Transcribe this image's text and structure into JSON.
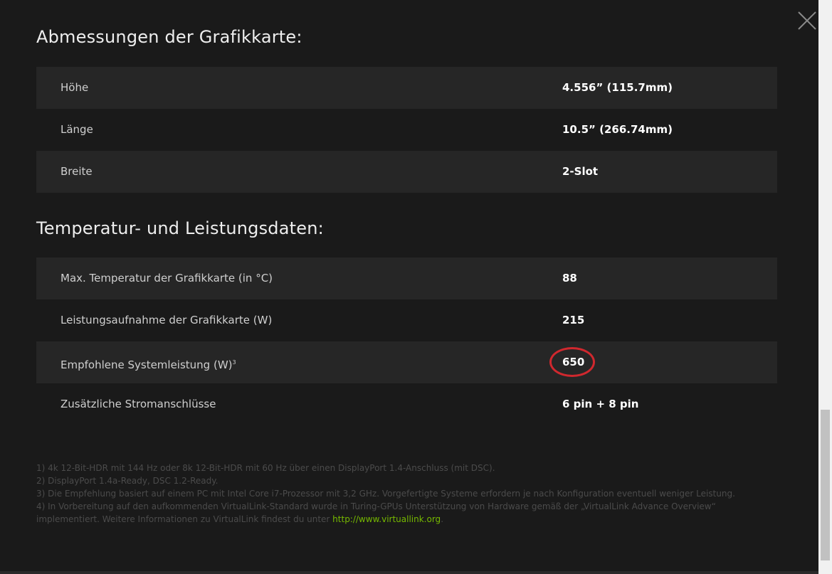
{
  "close_button": {
    "icon": "close-icon"
  },
  "sections": [
    {
      "title": "Abmessungen der Grafikkarte:",
      "rows": [
        {
          "label": "Höhe",
          "value": "4.556” (115.7mm)"
        },
        {
          "label": "Länge",
          "value": "10.5” (266.74mm)"
        },
        {
          "label": "Breite",
          "value": "2-Slot"
        }
      ]
    },
    {
      "title": "Temperatur- und Leistungsdaten:",
      "rows": [
        {
          "label": "Max. Temperatur der Grafikkarte (in °C)",
          "value": "88"
        },
        {
          "label": "Leistungsaufnahme der Grafikkarte (W)",
          "value": "215"
        },
        {
          "label": "Empfohlene Systemleistung (W)",
          "label_sup": "3",
          "value": "650",
          "highlighted": true
        },
        {
          "label": "Zusätzliche Stromanschlüsse",
          "value": "6 pin + 8 pin"
        }
      ]
    }
  ],
  "footnotes": {
    "line1": "1) 4k 12-Bit-HDR mit 144 Hz oder 8k 12-Bit-HDR mit 60 Hz über einen DisplayPort 1.4-Anschluss (mit DSC).",
    "line2": "2) DisplayPort 1.4a-Ready, DSC 1.2-Ready.",
    "line3": "3) Die Empfehlung basiert auf einem PC mit Intel Core i7-Prozessor mit 3,2 GHz. Vorgefertigte Systeme erfordern je nach Konfiguration eventuell weniger Leistung.",
    "line4": "4) In Vorbereitung auf den aufkommenden VirtualLink-Standard wurde in Turing-GPUs Unterstützung von Hardware gemäß der „VirtualLink Advance Overview“",
    "line5_text": "implementiert. Weitere Informationen zu VirtualLink findest du unter ",
    "line5_link": "http://www.virtuallink.org",
    "line5_end": "."
  },
  "colors": {
    "background": "#1a1a1a",
    "row_shade": "#262626",
    "highlight": "#d0282e",
    "link": "#76b900"
  }
}
